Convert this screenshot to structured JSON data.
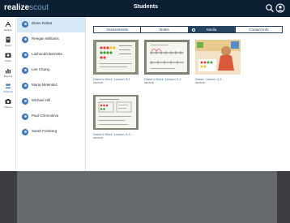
{
  "header": {
    "brand_part1": "realize",
    "brand_part2": "scout",
    "title": "Students",
    "icons": [
      "search-icon",
      "user-icon"
    ]
  },
  "rail": {
    "items": [
      {
        "label": "Realize",
        "icon": "realize-icon"
      },
      {
        "label": "Notes",
        "icon": "notes-icon"
      },
      {
        "label": "Photo",
        "icon": "photo-icon"
      },
      {
        "label": "Reports",
        "icon": "reports-icon"
      },
      {
        "label": "Students",
        "icon": "students-icon"
      },
      {
        "label": "Capture",
        "icon": "camera-icon"
      }
    ]
  },
  "students": [
    {
      "name": "Diane Rahat"
    },
    {
      "name": "Reegan Williams"
    },
    {
      "name": "Lashonda Barnette"
    },
    {
      "name": "Lee Chang"
    },
    {
      "name": "Maria Melendez"
    },
    {
      "name": "Michael Hill"
    },
    {
      "name": "Paul Chronoleva"
    },
    {
      "name": "Sarah Forsberg"
    }
  ],
  "tabs": [
    {
      "label": "Assessments"
    },
    {
      "label": "Notes"
    },
    {
      "label": "Media"
    },
    {
      "label": "Contact Info"
    }
  ],
  "media": [
    {
      "caption": "Diane's Work: Lesson 3-1",
      "date": "09/26/18"
    },
    {
      "caption": "Diane's Work: Lesson 3-2",
      "date": "09/26/18"
    },
    {
      "caption": "Diane: Lesson 3-3 ...",
      "date": "09/26/18"
    },
    {
      "caption": "Diane's Work: Lesson 3-3 ...",
      "date": "09/26/18"
    }
  ],
  "colors": {
    "header_bg": "#0d1f33",
    "accent": "#2f6fb2",
    "selected_row": "#d7e8f7",
    "tab_border": "#26435f"
  }
}
